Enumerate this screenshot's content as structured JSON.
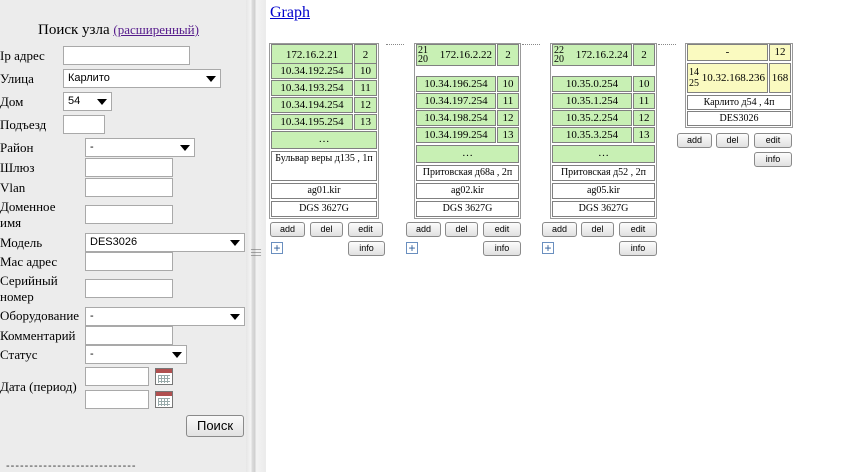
{
  "search": {
    "title": "Поиск узла",
    "advanced_link": "(расширенный)",
    "labels": {
      "ip": "Ip адрес",
      "street": "Улица",
      "house": "Дом",
      "entrance": "Подъезд",
      "district": "Район",
      "gateway": "Шлюз",
      "vlan": "Vlan",
      "domain": "Доменное имя",
      "model": "Модель",
      "mac": "Мас адрес",
      "serial": "Серийный номер",
      "equipment": "Оборудование",
      "comment": "Комментарий",
      "status": "Статус",
      "date": "Дата (период)"
    },
    "values": {
      "ip": "",
      "street": "Карлито",
      "house": "54",
      "entrance": "",
      "district": "-",
      "gateway": "",
      "vlan": "",
      "domain": "",
      "model": "DES3026",
      "mac": "",
      "serial": "",
      "equipment": "-",
      "comment": "",
      "status": "-",
      "date_from": "",
      "date_to": ""
    },
    "search_button": "Поиск",
    "separator": "----------------------------"
  },
  "graph_link": "Graph",
  "nodes": [
    {
      "header_ip": "172.16.2.21",
      "header_small": [],
      "header_count": "2",
      "ports": [
        {
          "ip": "10.34.192.254",
          "port": "10"
        },
        {
          "ip": "10.34.193.254",
          "port": "11"
        },
        {
          "ip": "10.34.194.254",
          "port": "12"
        },
        {
          "ip": "10.34.195.254",
          "port": "13"
        }
      ],
      "dots": "…",
      "address": "Бульвар веры д135 , 1п",
      "hostname": "ag01.kir",
      "model": "DGS 3627G",
      "buttons": {
        "add": "add",
        "del": "del",
        "edit": "edit",
        "info": "info"
      },
      "expand": "+"
    },
    {
      "header_ip": "172.16.2.22",
      "header_small": [
        "21",
        "20"
      ],
      "header_count": "2",
      "ports": [
        {
          "ip": "10.34.196.254",
          "port": "10"
        },
        {
          "ip": "10.34.197.254",
          "port": "11"
        },
        {
          "ip": "10.34.198.254",
          "port": "12"
        },
        {
          "ip": "10.34.199.254",
          "port": "13"
        }
      ],
      "dots": "…",
      "address": "Притовская д68а , 2п",
      "hostname": "ag02.kir",
      "model": "DGS 3627G",
      "buttons": {
        "add": "add",
        "del": "del",
        "edit": "edit",
        "info": "info"
      },
      "expand": "+"
    },
    {
      "header_ip": "172.16.2.24",
      "header_small": [
        "22",
        "20"
      ],
      "header_count": "2",
      "ports": [
        {
          "ip": "10.35.0.254",
          "port": "10"
        },
        {
          "ip": "10.35.1.254",
          "port": "11"
        },
        {
          "ip": "10.35.2.254",
          "port": "12"
        },
        {
          "ip": "10.35.3.254",
          "port": "13"
        }
      ],
      "dots": "…",
      "address": "Притовская д52 , 2п",
      "hostname": "ag05.kir",
      "model": "DGS 3627G",
      "buttons": {
        "add": "add",
        "del": "del",
        "edit": "edit",
        "info": "info"
      },
      "expand": "+"
    },
    {
      "header_ip": "-",
      "header_count": "12",
      "sub_ip": "10.32.168.236",
      "sub_small": [
        "14",
        "25"
      ],
      "sub_count": "168",
      "address": "Карлито д54 , 4п",
      "model": "DES3026",
      "buttons": {
        "add": "add",
        "del": "del",
        "edit": "edit",
        "info": "info"
      }
    }
  ],
  "colors": {
    "port_bg": "#c8f0b4",
    "highlight_bg": "#fafac0",
    "link": "#0000cc"
  }
}
